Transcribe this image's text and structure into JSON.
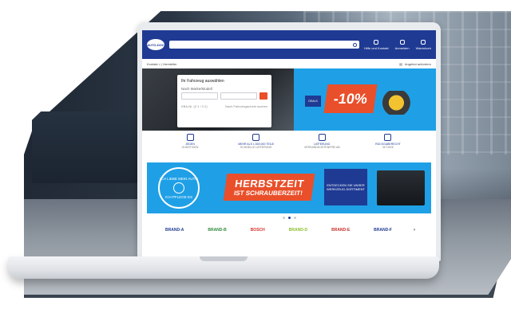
{
  "header": {
    "logo_text": "AUTO-DOC",
    "actions": [
      {
        "label": "Hilfe und Kontakt",
        "icon": "help-icon"
      },
      {
        "label": "Anmelden",
        "icon": "user-icon"
      },
      {
        "label": "Warenkorb",
        "icon": "cart-icon"
      }
    ]
  },
  "breadcrumb": "Kontakt  >  |  Hersteller",
  "subbar_right": "Angebot anfordern",
  "vehicle_card": {
    "title": "Ihr Fahrzeug auswählen",
    "field_label": "Nach Marke/Modell",
    "link_left": "KBA-Nr. (2.1 / 2.2)",
    "link_right": "Nach Fahrzeugschein suchen"
  },
  "hero": {
    "promo_tag": "DEALS",
    "discount": "-10%"
  },
  "features": [
    {
      "title": "JEDEN",
      "sub": "GÜNSTIGEN",
      "icon": "shield-icon"
    },
    {
      "title": "MEHR ALS 1.500.000 TEILE",
      "sub": "SCHNELLE LIEFERUNG",
      "icon": "package-icon"
    },
    {
      "title": "LIEFERUNG",
      "sub": "VERSANDKOSTENFREI AB",
      "icon": "truck-icon"
    },
    {
      "title": "RÜCKGABERECHT",
      "sub": "30 TAGE",
      "icon": "return-icon"
    }
  ],
  "banner": {
    "round_top": "ICH LIEBE MEIN AUTO",
    "round_bottom": "ICH PFLEGE ES",
    "headline_1": "HERBSTZEIT",
    "headline_2": "IST SCHRAUBERZEIT!",
    "sortiment_1": "ENTDECKEN SIE UNSER",
    "sortiment_2": "WERKZEUG-SORTIMENT"
  },
  "brands": [
    "BRAND-A",
    "BRAND-B",
    "BOSCH",
    "BRAND-D",
    "BRAND-E",
    "BRAND-F"
  ],
  "colors": {
    "primary": "#1f3a93",
    "accent": "#e94f2a",
    "banner_blue": "#1fa0e6"
  }
}
